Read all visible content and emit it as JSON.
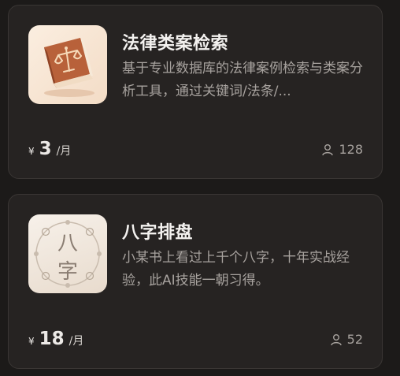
{
  "cards": [
    {
      "title": "法律类案检索",
      "description": "基于专业数据库的法律案例检索与类案分析工具，通过关键词/法条/...",
      "currency": "¥",
      "price": "3",
      "period": "/月",
      "users": "128",
      "icon": "law-book-scales-icon"
    },
    {
      "title": "八字排盘",
      "description": "小某书上看过上千个八字，十年实战经验，此AI技能一朝习得。",
      "currency": "¥",
      "price": "18",
      "period": "/月",
      "users": "52",
      "icon": "bazi-chart-icon",
      "icon_text": [
        "八",
        "字"
      ]
    }
  ],
  "colors": {
    "page_bg": "#1c1a19",
    "card_bg": "#262322",
    "title": "#f3f1ef",
    "muted": "#a7a29e",
    "book": "#b8613a"
  }
}
